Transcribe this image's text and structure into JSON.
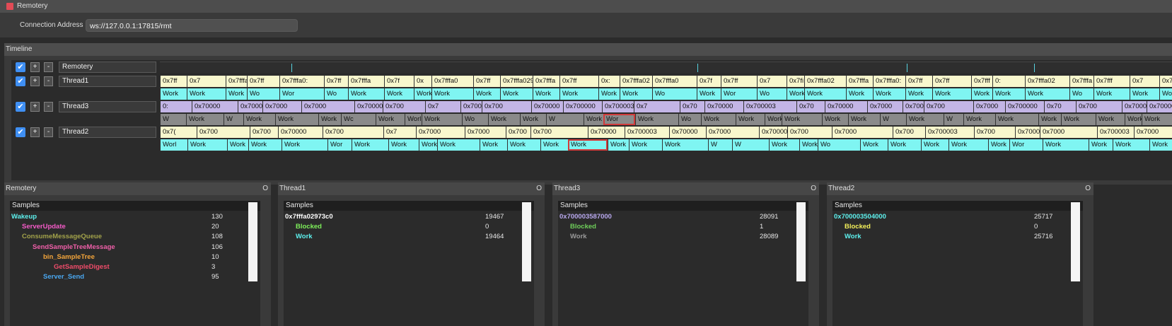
{
  "window": {
    "title": "Remotery",
    "connection_label": "Connection Address",
    "connection_value": "ws://127.0.0.1:17815/rmt"
  },
  "timeline": {
    "title": "Timeline",
    "rows": [
      {
        "name": "Remotery",
        "checked": true
      },
      {
        "name": "Thread1",
        "checked": true
      },
      {
        "name": "Thread3",
        "checked": true
      },
      {
        "name": "Thread2",
        "checked": true
      }
    ],
    "thread1_top": [
      "0x7ff",
      "0x7",
      "0x7fffa02",
      "0x7ff",
      "0x7fffa0:",
      "0x7ff",
      "0x7fffa",
      "0x7f",
      "0x",
      "0x7fffa0",
      "0x7ff",
      "0x7fffa029",
      "0x7fffa",
      "0x7ff",
      "0x:",
      "0x7fffa02",
      "0x7fffa0",
      "0x7f",
      "0x7ff",
      "0x7",
      "0x7fi",
      "0x7fffa02",
      "0x7fffa",
      "0x7fffa0:",
      "0x7ff",
      "0x7ff",
      "0x7fff",
      "0:",
      "0x7fffa02",
      "0x7fffa",
      "0x7fff",
      "0x7",
      "0x7fffa02"
    ],
    "thread1_bottom": [
      "Work",
      "Work",
      "Work",
      "Wo",
      "Wor",
      "Wo",
      "Work",
      "Work",
      "Work",
      "Work",
      "Work",
      "Work",
      "Work",
      "Work",
      "Work",
      "Work",
      "Wo",
      "Work",
      "Wor",
      "Wo",
      "Work",
      "Work",
      "Work",
      "Work",
      "Work",
      "Work",
      "Work",
      "Work",
      "Work",
      "Wo",
      "Work",
      "Work",
      "Work"
    ],
    "thread3_top": [
      "0:",
      "0x70000",
      "0x7000",
      "0x7000",
      "0x7000",
      "0x700003",
      "0x700",
      "0x7",
      "0x70000",
      "0x700",
      "0x70000",
      "0x700000",
      "0x700003",
      "0x7",
      "0x70",
      "0x70000",
      "0x700003",
      "0x70",
      "0x70000",
      "0x7000",
      "0x700003",
      "0x700",
      "0x7000",
      "0x700000",
      "0x70",
      "0x700",
      "0x7000",
      "0x700003"
    ],
    "thread3_bottom": [
      "W",
      "Work",
      "W",
      "Work",
      "Work",
      "Work",
      "Wc",
      "Work",
      "Worl",
      "Work",
      "Wo",
      "Work",
      "Work",
      "W",
      "Work",
      "Wor",
      "Work",
      "Wo",
      "Work",
      "Work",
      "Work",
      "Work",
      "Work",
      "Work",
      "W",
      "Work",
      "W",
      "Work",
      "Work",
      "Work",
      "Work",
      "Work",
      "Work",
      "Work"
    ],
    "thread2_top": [
      "0x7(",
      "0x700",
      "0x700",
      "0x70000",
      "0x700",
      "0x7",
      "0x7000",
      "0x7000",
      "0x700",
      "0x700",
      "0x70000",
      "0x700003",
      "0x70000",
      "0x7000",
      "0x700003",
      "0x700",
      "0x7000",
      "0x700",
      "0x700003",
      "0x700",
      "0x7000",
      "0x7000",
      "0x700003",
      "0x7000"
    ],
    "thread2_bottom": [
      "Worl",
      "Work",
      "Work",
      "Work",
      "Work",
      "Wor",
      "Work",
      "Work",
      "Work",
      "Work",
      "Work",
      "Work",
      "Work",
      "Work",
      "Work",
      "Work",
      "Work",
      "W",
      "W",
      "Work",
      "Work",
      "Wo",
      "Work",
      "Work",
      "Work",
      "Work",
      "Work",
      "Wor",
      "Work",
      "Work",
      "Work",
      "Work"
    ]
  },
  "panels": [
    {
      "title": "Remotery",
      "header": "Samples",
      "rows": [
        {
          "name": "Wakeup",
          "value": "130",
          "color": "#5ef1ee"
        },
        {
          "name": "ServerUpdate",
          "value": "20",
          "color": "#f55bc8"
        },
        {
          "name": "ConsumeMessageQueue",
          "value": "108",
          "color": "#a2a24a"
        },
        {
          "name": "SendSampleTreeMessage",
          "value": "106",
          "color": "#f05fa9"
        },
        {
          "name": "bin_SampleTree",
          "value": "10",
          "color": "#f4a53b"
        },
        {
          "name": "GetSampleDigest",
          "value": "3",
          "color": "#f04c6a"
        },
        {
          "name": "Server_Send",
          "value": "95",
          "color": "#4aa7f0"
        }
      ]
    },
    {
      "title": "Thread1",
      "header": "Samples",
      "rows": [
        {
          "name": "0x7fffa02973c0",
          "value": "19467",
          "color": "#ffffff"
        },
        {
          "name": "Blocked",
          "value": "0",
          "color": "#7ef05a"
        },
        {
          "name": "Work",
          "value": "19464",
          "color": "#5ef1ee"
        }
      ]
    },
    {
      "title": "Thread3",
      "header": "Samples",
      "rows": [
        {
          "name": "0x700003587000",
          "value": "28091",
          "color": "#b8a8ee"
        },
        {
          "name": "Blocked",
          "value": "1",
          "color": "#6fcf5a"
        },
        {
          "name": "Work",
          "value": "28089",
          "color": "#9a9a9a"
        }
      ]
    },
    {
      "title": "Thread2",
      "header": "Samples",
      "rows": [
        {
          "name": "0x700003504000",
          "value": "25717",
          "color": "#5ef1ee"
        },
        {
          "name": "Blocked",
          "value": "0",
          "color": "#f4f05a"
        },
        {
          "name": "Work",
          "value": "25716",
          "color": "#5ef1ee"
        }
      ]
    }
  ],
  "panel_close_glyph": "O",
  "checkbox_glyph": "✔",
  "plus_glyph": "+",
  "minus_glyph": "-"
}
